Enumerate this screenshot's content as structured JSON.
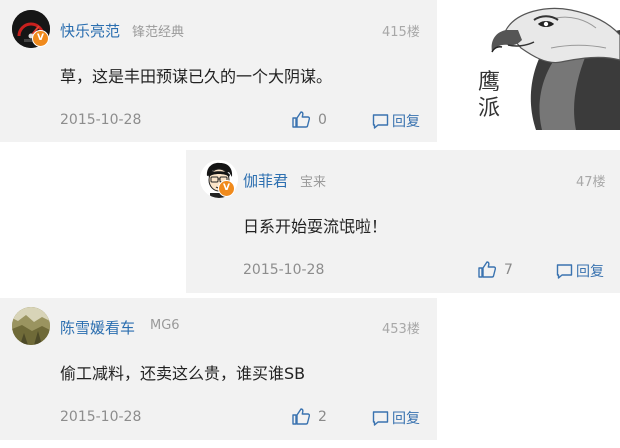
{
  "comments": [
    {
      "username": "快乐亮范",
      "level": "锋范经典",
      "floor": "415楼",
      "content": "草，这是丰田预谋已久的一个大阴谋。",
      "date": "2015-10-28",
      "likes": "0",
      "reply_label": "回复",
      "badge": "V"
    },
    {
      "username": "伽菲君",
      "level": "宝来",
      "floor": "47楼",
      "content": "日系开始耍流氓啦！",
      "date": "2015-10-28",
      "likes": "7",
      "reply_label": "回复",
      "badge": "V"
    },
    {
      "username": "陈雪媛看车",
      "level": "MG6",
      "floor": "453楼",
      "content": "偷工减料，还卖这么贵，谁买谁SB",
      "date": "2015-10-28",
      "likes": "2",
      "reply_label": "回复"
    }
  ],
  "image": {
    "text_line1": "鹰",
    "text_line2": "派",
    "icon": "eagle-icon"
  },
  "colors": {
    "card_bg": "#f2f2f2",
    "username": "#2c6fb0",
    "badge": "#f08a1c",
    "action": "#3a73b0"
  }
}
